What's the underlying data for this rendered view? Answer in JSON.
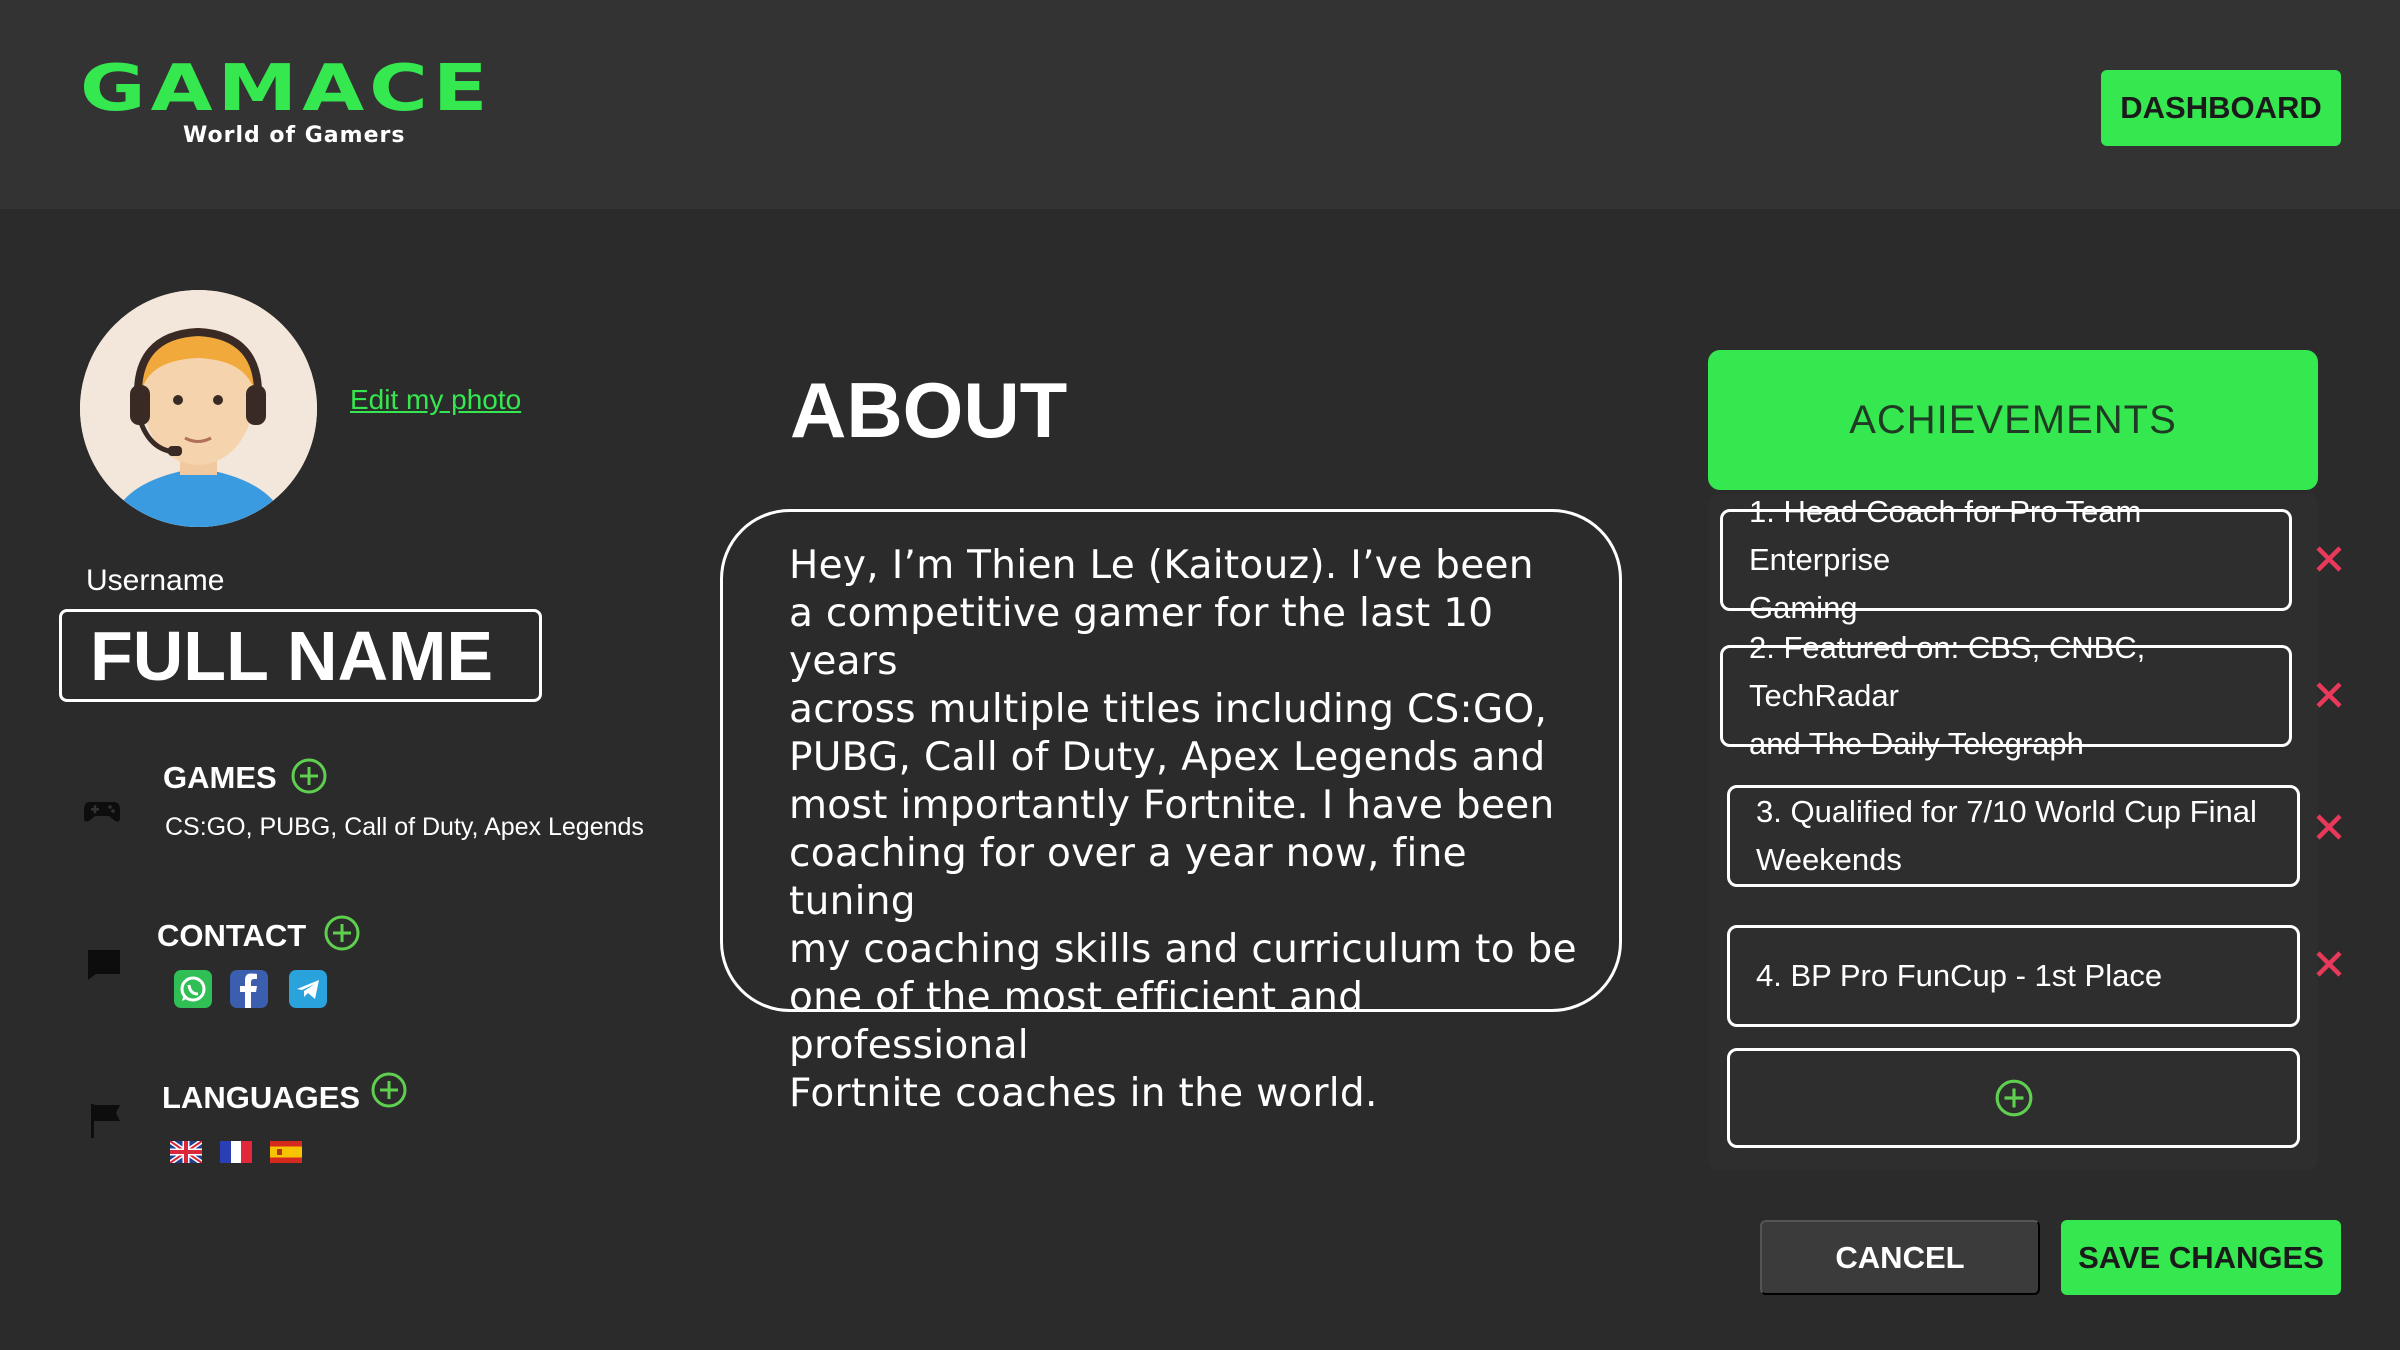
{
  "header": {
    "logo_title": "GAMACE",
    "logo_subtitle": "World of Gamers",
    "dashboard_label": "DASHBOARD"
  },
  "profile": {
    "avatar_icon": "gamer-avatar-icon",
    "edit_photo_label": "Edit my photo",
    "username_label": "Username",
    "full_name": "FULL NAME"
  },
  "games": {
    "title": "GAMES",
    "icon": "gamepad-icon",
    "list": "CS:GO, PUBG, Call of Duty, Apex Legends"
  },
  "contact": {
    "title": "CONTACT",
    "icon": "chat-icon",
    "apps": [
      "whatsapp-icon",
      "facebook-icon",
      "telegram-icon"
    ]
  },
  "languages": {
    "title": "LANGUAGES",
    "icon": "flag-icon",
    "flags": [
      "uk-flag-icon",
      "france-flag-icon",
      "spain-flag-icon"
    ]
  },
  "about": {
    "title": "ABOUT",
    "lines": [
      "Hey, I’m Thien Le (Kaitouz). I’ve been",
      "a competitive gamer for the last 10 years",
      "across multiple titles including CS:GO,",
      "PUBG, Call of Duty, Apex Legends and",
      "most importantly Fortnite. I have been",
      "coaching for over a year now, fine tuning",
      "my coaching skills and curriculum to be",
      "one of the most efficient and professional",
      "Fortnite coaches in the world."
    ]
  },
  "achievements": {
    "title": "ACHIEVEMENTS",
    "items": [
      {
        "line1": "1. Head Coach for Pro Team Enterprise",
        "line2": "Gaming"
      },
      {
        "line1": "2. Featured on: CBS, CNBC, TechRadar",
        "line2": "and The Daily Telegraph"
      },
      {
        "line1": "3. Qualified for 7/10 World Cup Final",
        "line2": "Weekends"
      },
      {
        "line1": "4. BP Pro FunCup - 1st Place",
        "line2": ""
      }
    ]
  },
  "footer": {
    "cancel_label": "CANCEL",
    "save_label": "SAVE CHANGES"
  },
  "colors": {
    "accent": "#35e84f",
    "background": "#2b2b2b",
    "header_bg": "#333333",
    "remove": "#e8395a"
  }
}
